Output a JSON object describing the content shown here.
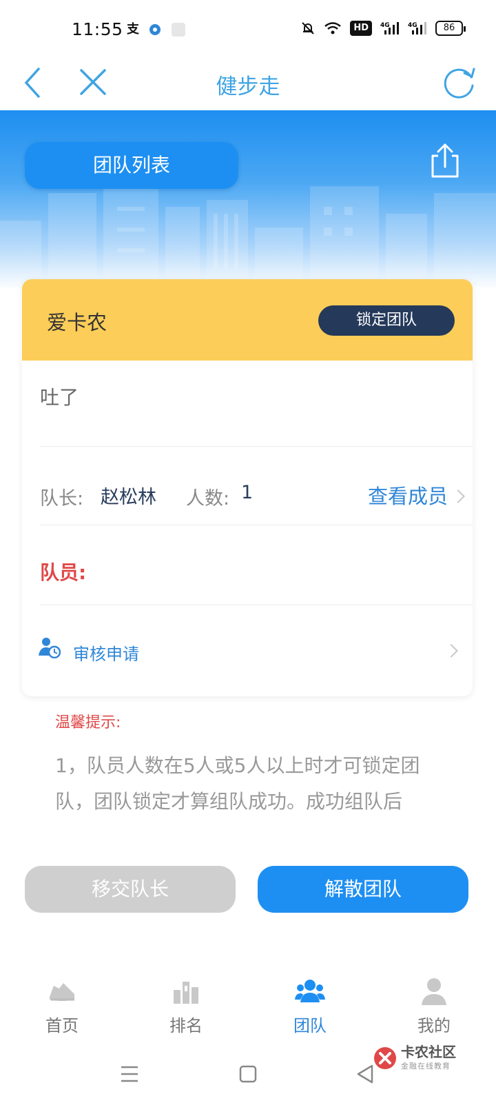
{
  "status_bar": {
    "time": "11:55",
    "left_icons": [
      "alipay-icon",
      "app-circle-icon",
      "app-square-icon"
    ],
    "right_icons": [
      "mute-bell-icon",
      "wifi-icon",
      "hd-icon",
      "signal-4g-icon",
      "signal-4g-icon"
    ],
    "hd_label": "HD",
    "battery": "86"
  },
  "navbar": {
    "title": "健步走"
  },
  "hero": {
    "team_list_label": "团队列表"
  },
  "team_card": {
    "name": "爱卡农",
    "lock_label": "锁定团队",
    "slogan": "吐了",
    "leader_label": "队长:",
    "leader_name": "赵松林",
    "count_label": "人数:",
    "count_value": "1",
    "view_members_label": "查看成员",
    "members_label": "队员:",
    "review_label": "审核申请"
  },
  "tips": {
    "title": "温馨提示:",
    "body": "1，队员人数在5人或5人以上时才可锁定团队，团队锁定才算组队成功。成功组队后"
  },
  "actions": {
    "transfer_label": "移交队长",
    "dissolve_label": "解散团队"
  },
  "tabbar": {
    "items": [
      {
        "label": "首页",
        "icon": "shoe-icon"
      },
      {
        "label": "排名",
        "icon": "ranking-icon"
      },
      {
        "label": "团队",
        "icon": "team-icon",
        "active": true
      },
      {
        "label": "我的",
        "icon": "user-icon"
      }
    ]
  },
  "watermark": {
    "title": "卡农社区",
    "subtitle": "金融在线教育"
  },
  "colors": {
    "accent": "#1e8ff2",
    "title_blue": "#3fa4e3",
    "card_header": "#fccd58",
    "lock_button": "#25395a",
    "warning_red": "#e04848",
    "disabled_grey": "#cfcfcf"
  }
}
